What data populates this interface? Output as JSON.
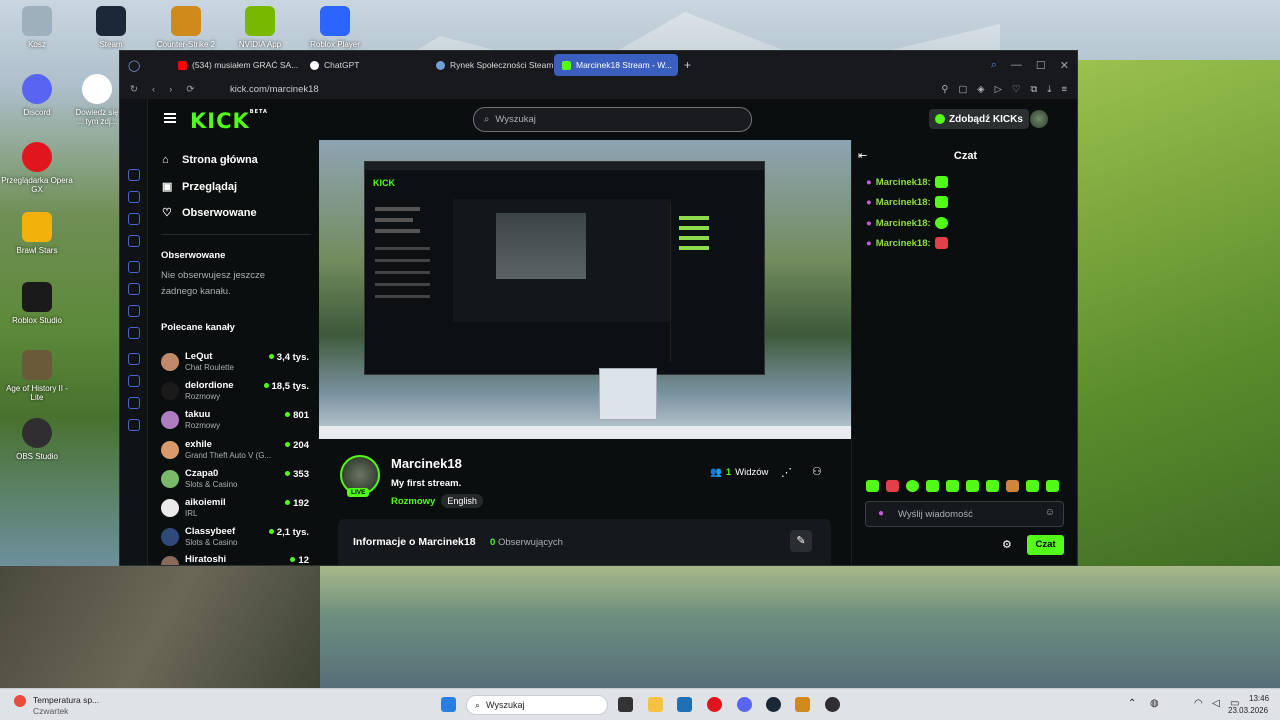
{
  "desktop": {
    "icons": [
      {
        "label": "Kosz",
        "color": "#9fb0bd"
      },
      {
        "label": "Steam",
        "color": "#1b2838"
      },
      {
        "label": "Counter-Strike 2",
        "color": "#d08a1c"
      },
      {
        "label": "NVIDIA App",
        "color": "#76b900"
      },
      {
        "label": "Roblox Player",
        "color": "#2b64ff"
      },
      {
        "label": "Discord",
        "color": "#5865f2"
      },
      {
        "label": "Dowiedz się ... tym zdj...",
        "color": "#ffffff"
      },
      {
        "label": "Przeglądarka Opera GX",
        "color": "#e0151d"
      },
      {
        "label": "Brawl Stars",
        "color": "#f2b10b"
      },
      {
        "label": "Roblox Studio",
        "color": "#1a1a1a"
      },
      {
        "label": "Age of History II - Lite",
        "color": "#6b5a3a"
      },
      {
        "label": "OBS Studio",
        "color": "#302e31"
      }
    ]
  },
  "browser": {
    "tabs": [
      {
        "label": "(534) musiałem GRAĆ SA...",
        "color": "#ff0000"
      },
      {
        "label": "ChatGPT",
        "color": "#ffffff"
      },
      {
        "label": "Rynek Społeczności Steam",
        "color": "#1b2838"
      },
      {
        "label": "Marcinek18 Stream - W...",
        "color": "#53fc18"
      }
    ],
    "url": "kick.com/marcinek18"
  },
  "kick": {
    "logo": "KICK",
    "logo_badge": "BETA",
    "search_placeholder": "Wyszukaj",
    "kicks_button": "Zdobądź KICKs",
    "nav": {
      "home": "Strona główna",
      "browse": "Przeglądaj",
      "following": "Obserwowane"
    },
    "following_title": "Obserwowane",
    "following_empty": "Nie obserwujesz jeszcze żadnego kanału.",
    "recommended_title": "Polecane kanały",
    "channels": [
      {
        "name": "LeQut",
        "category": "Chat Roulette",
        "viewers": "3,4 tys.",
        "color": "#c08a6a"
      },
      {
        "name": "delordione",
        "category": "Rozmowy",
        "viewers": "18,5 tys.",
        "color": "#1a1a1a"
      },
      {
        "name": "takuu",
        "category": "Rozmowy",
        "viewers": "801",
        "color": "#b07cc0"
      },
      {
        "name": "exhile",
        "category": "Grand Theft Auto V (G...",
        "viewers": "204",
        "color": "#d89a6a"
      },
      {
        "name": "Czapa0",
        "category": "Slots & Casino",
        "viewers": "353",
        "color": "#7ab86a"
      },
      {
        "name": "aikoiemil",
        "category": "IRL",
        "viewers": "192",
        "color": "#eaeaea"
      },
      {
        "name": "Classybeef",
        "category": "Slots & Casino",
        "viewers": "2,1 tys.",
        "color": "#2f4a7a"
      },
      {
        "name": "Hiratoshi",
        "category": "",
        "viewers": "12",
        "color": "#8a6a5a"
      }
    ],
    "stream": {
      "live_badge": "LIVE",
      "channel": "Marcinek18",
      "title": "My first stream.",
      "category": "Rozmowy",
      "language": "English",
      "viewers_count": "1",
      "viewers_label": "Widzów",
      "about_title": "Informacje o Marcinek18",
      "followers_count": "0",
      "followers_label": "Obserwujących"
    },
    "chat": {
      "title": "Czat",
      "messages": [
        {
          "user": "Marcinek18:"
        },
        {
          "user": "Marcinek18:"
        },
        {
          "user": "Marcinek18:"
        },
        {
          "user": "Marcinek18:"
        }
      ],
      "input_placeholder": "Wyślij wiadomość",
      "send_button": "Czat"
    }
  },
  "taskbar": {
    "weather": "Temperatura sp...",
    "weather_sub": "Czwartek",
    "search_placeholder": "Wyszukaj",
    "time": "13:46",
    "date": "23.03.2026"
  }
}
